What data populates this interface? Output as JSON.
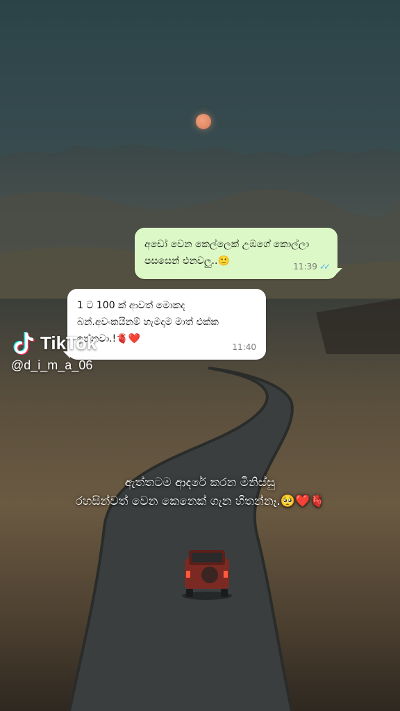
{
  "chat": {
    "outgoing": {
      "text": "අඩෝ වෙන කෙල්ලෙක් උඹගේ කොල්ලා\nපසසෙන් එනවලු..🙂",
      "time": "11:39",
      "ticks": "✓✓"
    },
    "incoming": {
      "text": "1 ට 100 ක් ආවත් මොකද\nබන්.අවංකයිනම් හැමදාම මාත් එක්ක\nඉන්නවා.!🫀❤️",
      "time": "11:40"
    }
  },
  "watermark": {
    "brand": "TikTok",
    "handle": "@d_i_m_a_06"
  },
  "caption": "ඇත්තටම ආදරේ කරන මිනිස්සු\nරහසින්වත් වෙන කෙනෙක් ගැන හිතන්නෑ.🥺❤️🫀",
  "colors": {
    "outgoing_bubble": "#dcf8c6",
    "incoming_bubble": "#ffffff",
    "read_ticks": "#4fb6ec",
    "moon": "#e38a66"
  }
}
